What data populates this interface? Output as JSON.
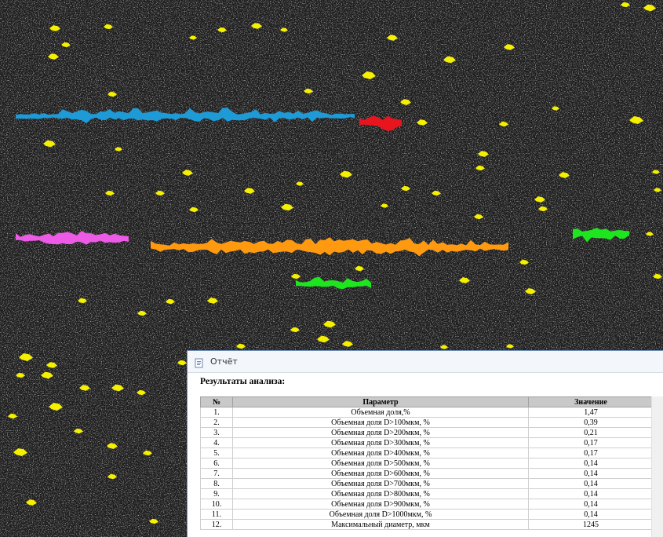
{
  "report_window": {
    "title": "Отчёт",
    "heading": "Результаты анализа:",
    "table": {
      "columns": [
        "№",
        "Параметр",
        "Значение"
      ],
      "rows": [
        {
          "num": "1.",
          "param": "Объемная доля,%",
          "value": "1,47"
        },
        {
          "num": "2.",
          "param": "Объемная доля D>100мкм, %",
          "value": "0,39"
        },
        {
          "num": "3.",
          "param": "Объемная доля D>200мкм, %",
          "value": "0,21"
        },
        {
          "num": "4.",
          "param": "Объемная доля D>300мкм, %",
          "value": "0,17"
        },
        {
          "num": "5.",
          "param": "Объемная доля D>400мкм, %",
          "value": "0,17"
        },
        {
          "num": "6.",
          "param": "Объемная доля D>500мкм, %",
          "value": "0,14"
        },
        {
          "num": "7.",
          "param": "Объемная доля D>600мкм, %",
          "value": "0,14"
        },
        {
          "num": "8.",
          "param": "Объемная доля D>700мкм, %",
          "value": "0,14"
        },
        {
          "num": "9.",
          "param": "Объемная доля D>800мкм, %",
          "value": "0,14"
        },
        {
          "num": "10.",
          "param": "Объемная доля D>900мкм, %",
          "value": "0,14"
        },
        {
          "num": "11.",
          "param": "Объемная доля D>1000мкм, %",
          "value": "0,14"
        },
        {
          "num": "12.",
          "param": "Максимальный диаметр, мкм",
          "value": "1245"
        }
      ]
    }
  },
  "micrograph": {
    "background_color": "#1e1e1e",
    "inclusion_colors": {
      "small": "#f5f000",
      "blue": "#1e9ad6",
      "red": "#e8141e",
      "magenta": "#ec5ae6",
      "orange": "#ff9a10",
      "green": "#1ee61e"
    }
  }
}
